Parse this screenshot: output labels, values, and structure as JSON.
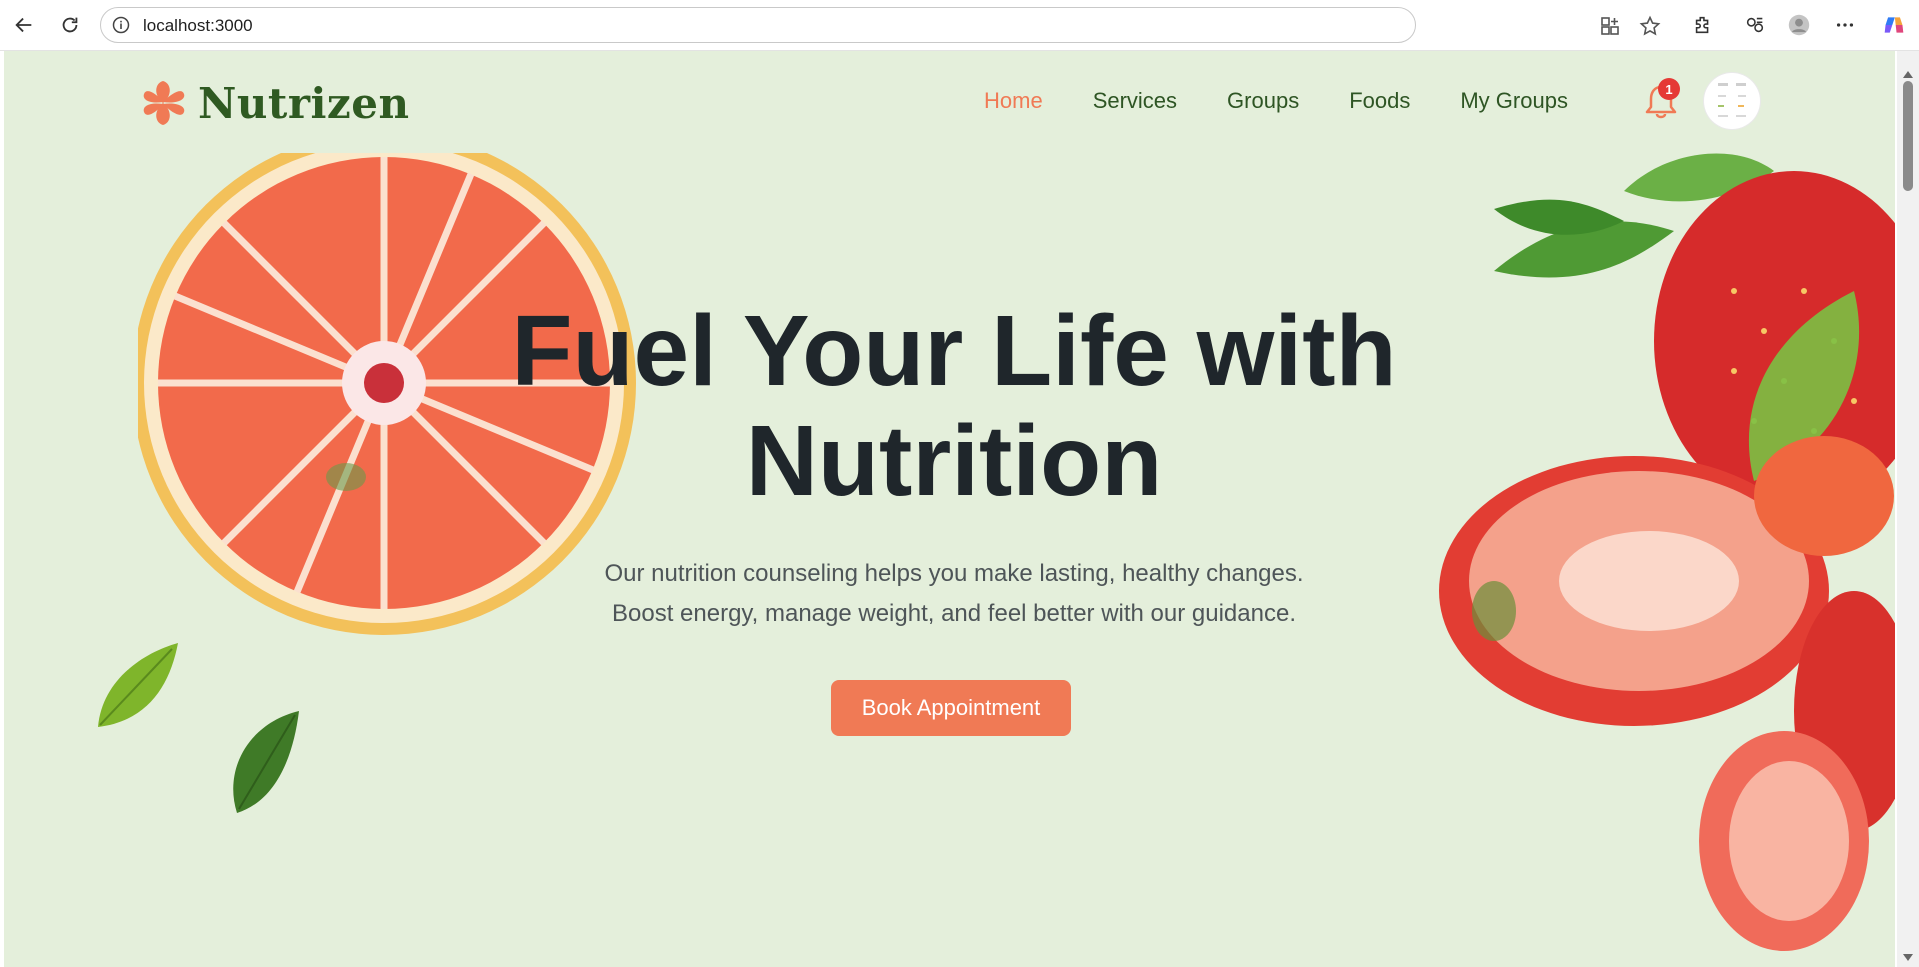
{
  "browser": {
    "url": "localhost:3000",
    "icons": [
      "back-arrow-icon",
      "reload-icon",
      "site-info-icon",
      "app-available-icon",
      "star-icon",
      "extensions-icon",
      "collections-icon",
      "profile-icon",
      "more-icon",
      "copilot-icon"
    ]
  },
  "site": {
    "logo_text": "Nutrizen",
    "brand_color": "#2f5a22",
    "accent_color": "#f07a55",
    "nav": {
      "items": [
        {
          "label": "Home",
          "active": true
        },
        {
          "label": "Services",
          "active": false
        },
        {
          "label": "Groups",
          "active": false
        },
        {
          "label": "Foods",
          "active": false
        },
        {
          "label": "My Groups",
          "active": false
        }
      ]
    },
    "notifications_count": "1"
  },
  "hero": {
    "title_line1": "Fuel Your Life with",
    "title_line2": "Nutrition",
    "subtitle_line1": "Our nutrition counseling helps you make lasting, healthy changes.",
    "subtitle_line2": "Boost energy, manage weight, and feel better with our guidance.",
    "cta_label": "Book Appointment"
  }
}
